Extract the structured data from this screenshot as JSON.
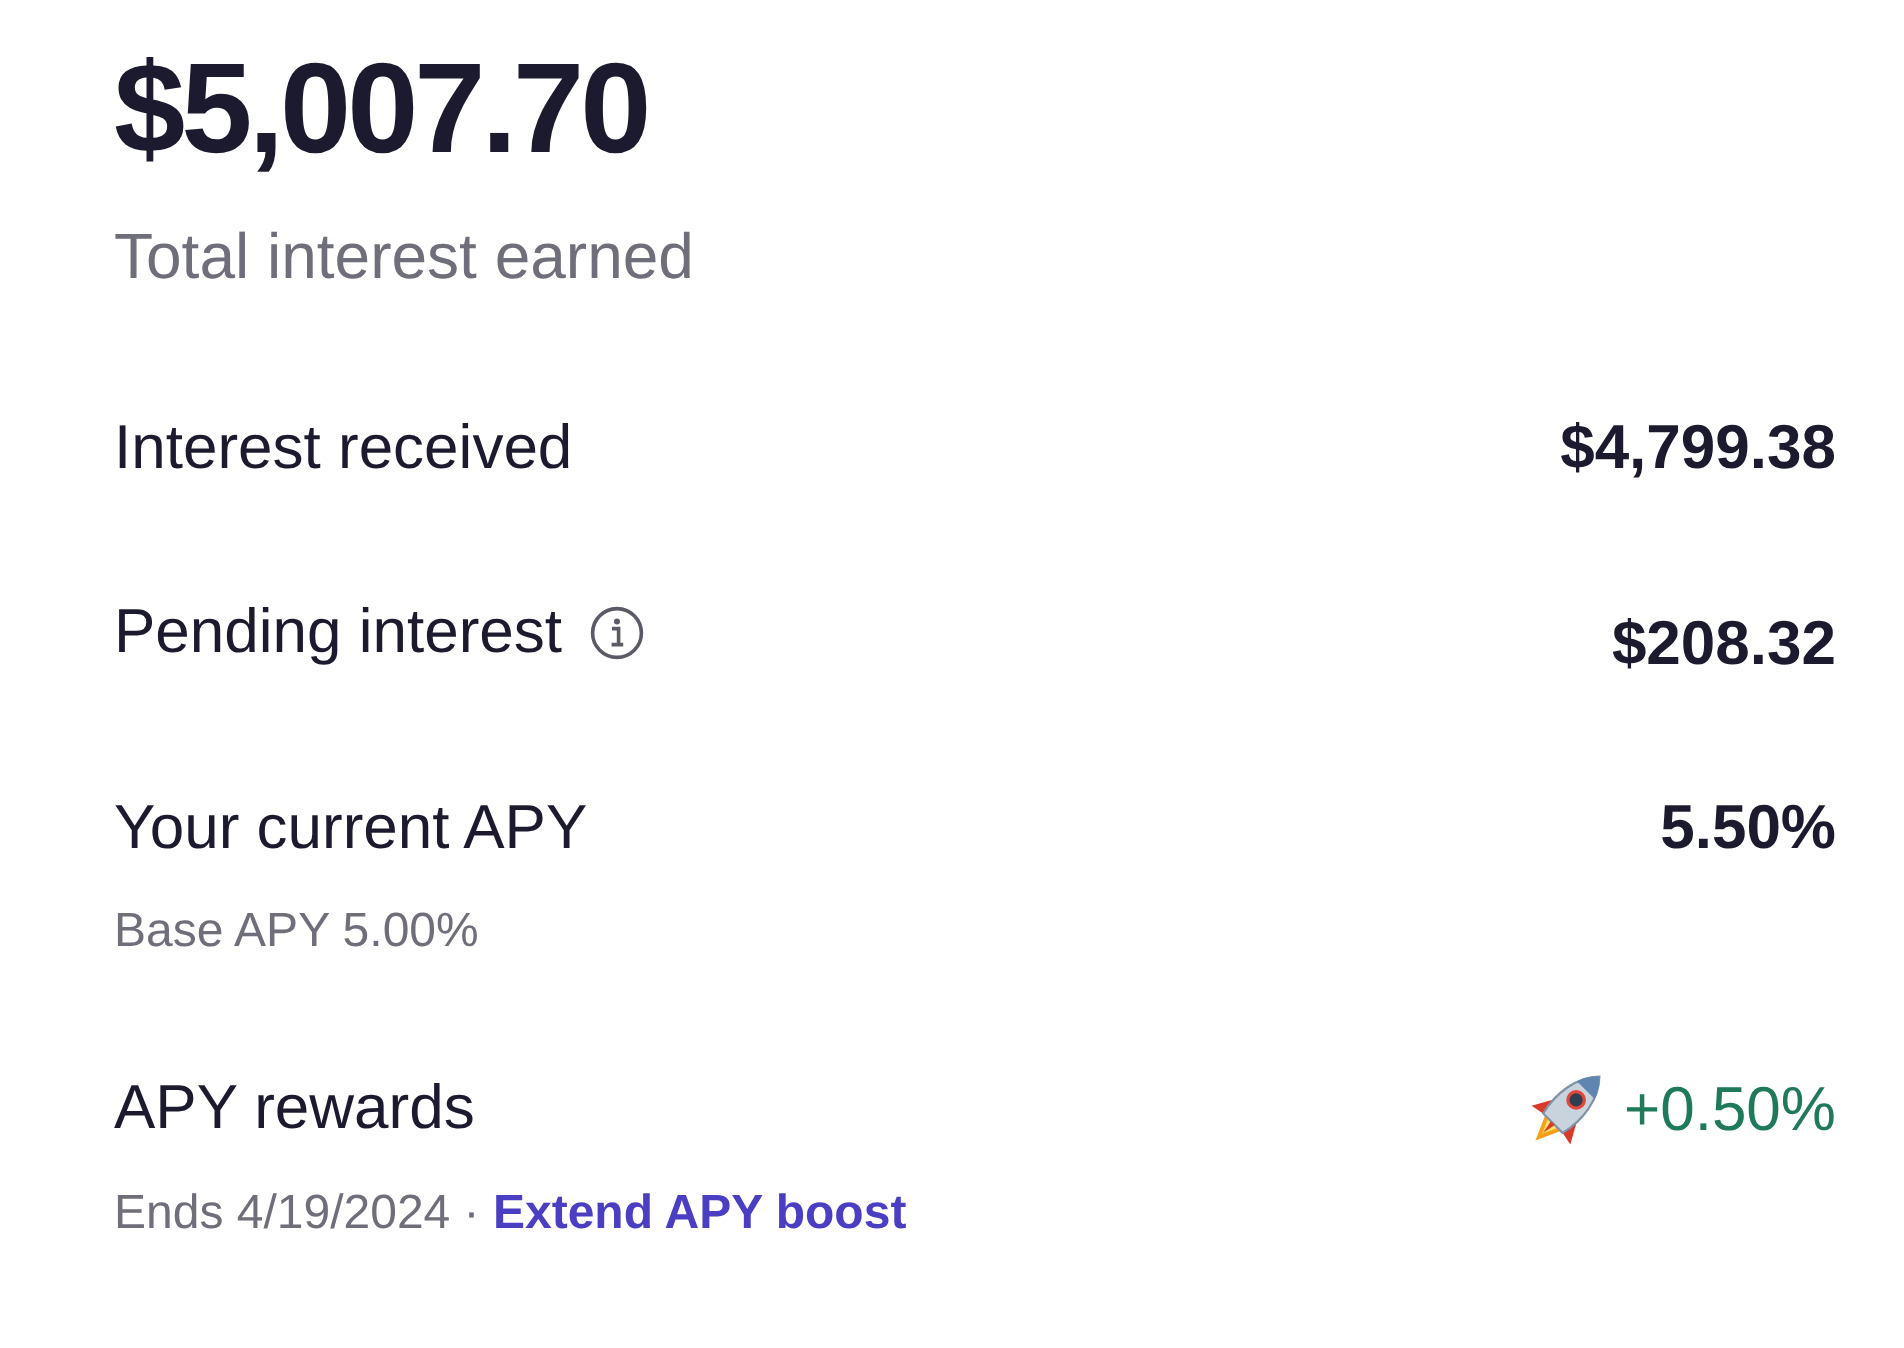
{
  "total": {
    "amount": "$5,007.70",
    "label": "Total interest earned"
  },
  "rows": [
    {
      "kind": "plain",
      "label": "Interest received",
      "value": "$4,799.38"
    },
    {
      "kind": "info",
      "label": "Pending interest",
      "value": "$208.32"
    },
    {
      "kind": "plain",
      "label": "Your current APY",
      "value": "5.50%",
      "note": "Base APY 5.00%"
    },
    {
      "kind": "reward",
      "label": "APY rewards",
      "value": "+0.50%",
      "note": "Ends 4/19/2024 ·",
      "link": "Extend APY boost"
    }
  ]
}
